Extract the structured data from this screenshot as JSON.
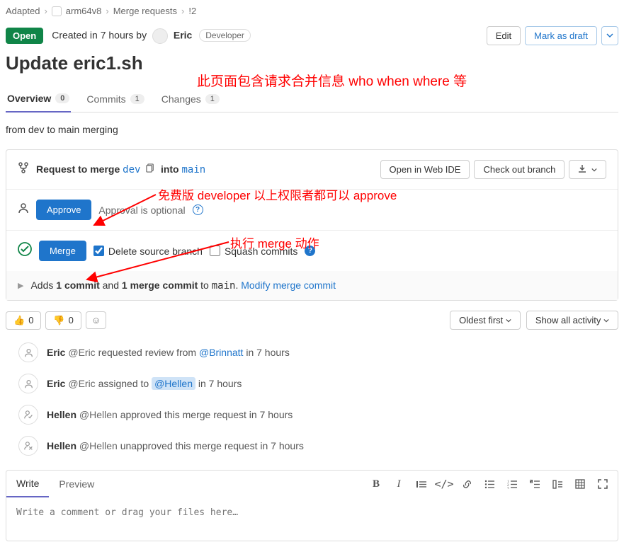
{
  "breadcrumbs": {
    "root": "Adapted",
    "project": "arm64v8",
    "section": "Merge requests",
    "id": "!2"
  },
  "status_badge": "Open",
  "created_text": "Created in 7 hours by",
  "author": "Eric",
  "role": "Developer",
  "actions": {
    "edit": "Edit",
    "mark_draft": "Mark as draft"
  },
  "title": "Update eric1.sh",
  "annotations": {
    "top": "此页面包含请求合并信息 who when where 等",
    "mid": "免费版 developer 以上权限者都可以 approve",
    "merge": "执行 merge 动作"
  },
  "tabs": [
    {
      "label": "Overview",
      "count": "0",
      "active": true
    },
    {
      "label": "Commits",
      "count": "1",
      "active": false
    },
    {
      "label": "Changes",
      "count": "1",
      "active": false
    }
  ],
  "description": "from dev to main merging",
  "merge_panel": {
    "req_text": "Request to merge",
    "src_branch": "dev",
    "into_text": "into",
    "dst_branch": "main",
    "open_ide": "Open in Web IDE",
    "checkout": "Check out branch",
    "approve_btn": "Approve",
    "approval_note": "Approval is optional",
    "merge_btn": "Merge",
    "delete_src": "Delete source branch",
    "squash": "Squash commits",
    "expand_adds": "Adds ",
    "expand_commit": "1 commit",
    "expand_and": " and ",
    "expand_merge_commit": "1 merge commit",
    "expand_to": " to ",
    "expand_branch": "main",
    "expand_dot": ". ",
    "modify_link": "Modify merge commit"
  },
  "reactions": {
    "thumbs_up": "0",
    "thumbs_down": "0"
  },
  "sort": {
    "oldest": "Oldest first",
    "show_all": "Show all activity"
  },
  "activity": [
    {
      "icon": "user",
      "actor": "Eric",
      "handle": "@Eric",
      "text_before": " requested review from ",
      "mention": "@Brinnatt",
      "text_after": " in 7 hours",
      "mention_style": "link"
    },
    {
      "icon": "user",
      "actor": "Eric",
      "handle": "@Eric",
      "text_before": " assigned to ",
      "mention": "@Hellen",
      "text_after": " in 7 hours",
      "mention_style": "highlight"
    },
    {
      "icon": "check",
      "actor": "Hellen",
      "handle": "@Hellen",
      "text_before": " approved this merge request in 7 hours",
      "mention": "",
      "text_after": "",
      "mention_style": "none"
    },
    {
      "icon": "uncheck",
      "actor": "Hellen",
      "handle": "@Hellen",
      "text_before": " unapproved this merge request in 7 hours",
      "mention": "",
      "text_after": "",
      "mention_style": "none"
    }
  ],
  "editor": {
    "write_tab": "Write",
    "preview_tab": "Preview",
    "placeholder": "Write a comment or drag your files here…"
  }
}
